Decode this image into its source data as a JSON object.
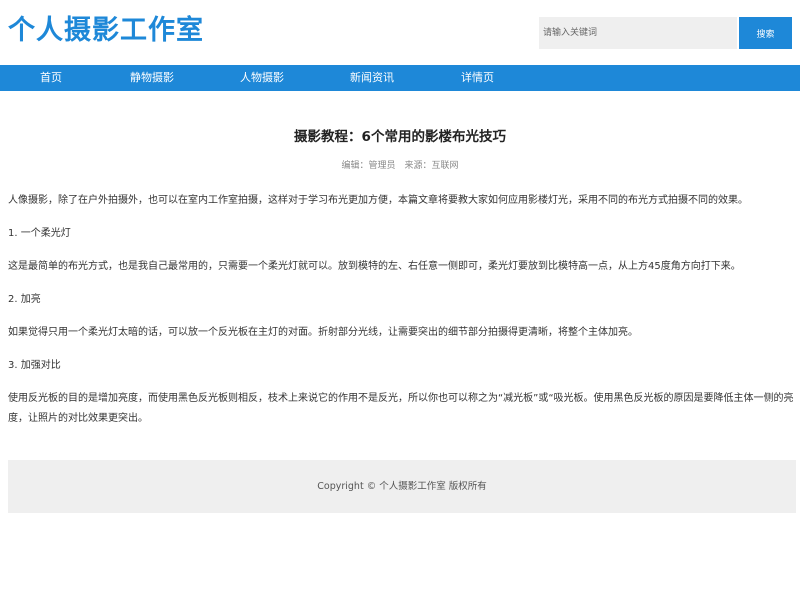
{
  "header": {
    "logo": "个人摄影工作室",
    "search_placeholder": "请输入关键词",
    "search_button": "搜索"
  },
  "nav": {
    "items": [
      "首页",
      "静物摄影",
      "人物摄影",
      "新闻资讯",
      "详情页"
    ]
  },
  "article": {
    "title": "摄影教程：6个常用的影楼布光技巧",
    "meta": "编辑：管理员　来源：互联网",
    "paragraphs": [
      "人像摄影，除了在户外拍摄外，也可以在室内工作室拍摄，这样对于学习布光更加方便，本篇文章将要教大家如何应用影楼灯光，采用不同的布光方式拍摄不同的效果。",
      "1. 一个柔光灯",
      "这是最简单的布光方式，也是我自己最常用的，只需要一个柔光灯就可以。放到模特的左、右任意一侧即可，柔光灯要放到比模特高一点，从上方45度角方向打下来。",
      "2. 加亮",
      "如果觉得只用一个柔光灯太暗的话，可以放一个反光板在主灯的对面。折射部分光线，让需要突出的细节部分拍摄得更清晰，将整个主体加亮。",
      "3. 加强对比",
      "使用反光板的目的是增加亮度，而使用黑色反光板则相反，枝术上来说它的作用不是反光，所以你也可以称之为“减光板”或“吸光板。使用黑色反光板的原因是要降低主体一侧的亮度，让照片的对比效果更突出。"
    ]
  },
  "footer": {
    "copyright": "Copyright © 个人摄影工作室 版权所有"
  },
  "colors": {
    "accent": "#1e88d8",
    "footer_bg": "#efefef",
    "search_bg": "#efefef"
  }
}
